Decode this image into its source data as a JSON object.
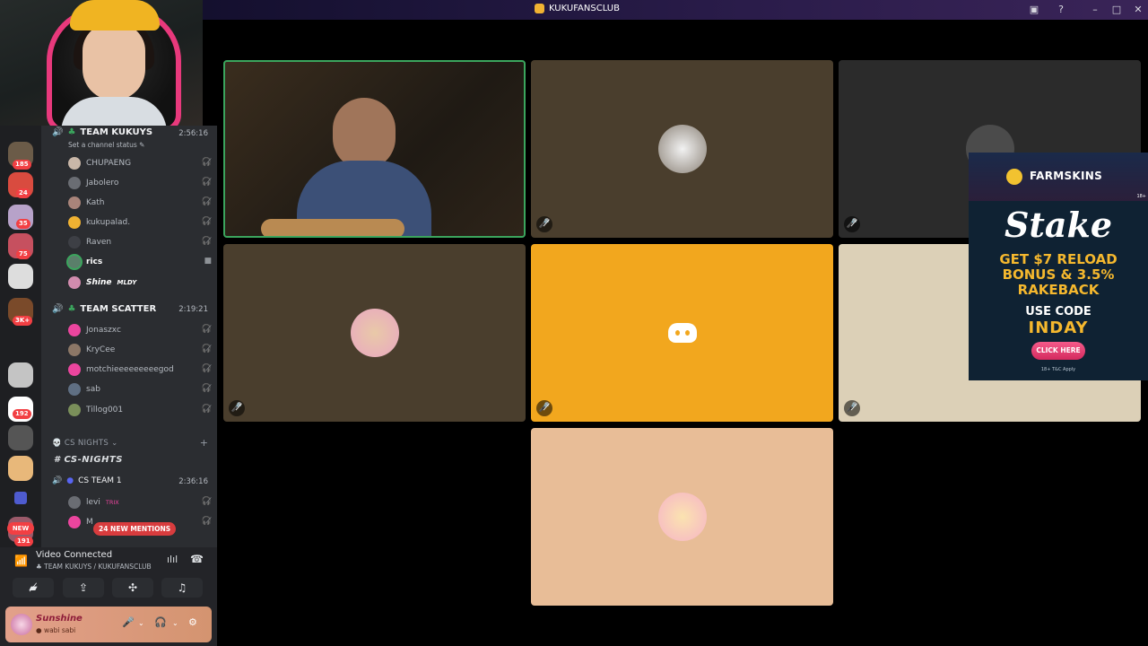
{
  "window": {
    "title": "KUKUFANSCLUB"
  },
  "voice_groups": [
    {
      "name": "TEAM KUKUYS",
      "time": "2:56:16",
      "status_placeholder": "Set a channel status",
      "members": [
        {
          "name": "CHUPAENG",
          "color": "#c9b7a8"
        },
        {
          "name": "Jabolero",
          "color": "#6a6d73"
        },
        {
          "name": "Kath",
          "color": "#a9847a"
        },
        {
          "name": "kukupalad.",
          "color": "#f0b232"
        },
        {
          "name": "Raven",
          "color": "#3d3f45"
        },
        {
          "name": "rics",
          "color": "#5a7f6a"
        },
        {
          "name": "Shine",
          "color": "#d28cae",
          "tag": "MLDY"
        }
      ]
    },
    {
      "name": "TEAM SCATTER",
      "time": "2:19:21",
      "members": [
        {
          "name": "Jonaszxc",
          "color": "#eb459e"
        },
        {
          "name": "KryCee",
          "color": "#8c7766"
        },
        {
          "name": "motchieeeeeeeeegod",
          "color": "#eb459e"
        },
        {
          "name": "sab",
          "color": "#5f6f83"
        },
        {
          "name": "Tillog001",
          "color": "#7a8f5a"
        }
      ]
    }
  ],
  "category": {
    "name": "CS NIGHTS",
    "text_channel": "CS-NIGHTS"
  },
  "cs_team": {
    "name": "CS TEAM 1",
    "time": "2:36:16",
    "members": [
      {
        "name": "levi",
        "color": "#6a6d73",
        "tag": "TRIX"
      },
      {
        "name": "M",
        "color": "#eb459e"
      }
    ]
  },
  "mentions_label": "24 NEW MENTIONS",
  "new_label": "NEW",
  "server_badges": [
    "185",
    "24",
    "35",
    "75",
    "3K+",
    "192",
    "191"
  ],
  "voice_panel": {
    "status": "Video Connected",
    "location": "TEAM KUKUYS / KUKUFANSCLUB"
  },
  "user": {
    "name": "Sunshine",
    "status": "wabi sabi"
  },
  "video_tiles": [
    {
      "kind": "video",
      "bg": "#2d2418",
      "speaking": true
    },
    {
      "kind": "avatar",
      "bg": "#4a3e2d",
      "avatar": "#d9d5cf"
    },
    {
      "kind": "avatar",
      "bg": "#2b2b2b",
      "avatar": "#4b4b4b"
    },
    {
      "kind": "avatar",
      "bg": "#4a3e2d",
      "avatar": "#e9a7c1"
    },
    {
      "kind": "discord",
      "bg": "#f2a71e"
    },
    {
      "kind": "avatar",
      "bg": "#dcd0b7",
      "avatar": "#cbb894"
    },
    {
      "kind": "avatar",
      "bg": "#e8bd97",
      "avatar": "#f6b4c7"
    }
  ],
  "ad": {
    "brand1": "FARMSKINS",
    "brand2": "Stake",
    "line1": "GET $7 RELOAD",
    "line2": "BONUS & 3.5%",
    "line3": "RAKEBACK",
    "code_label": "USE CODE",
    "code": "INDAY",
    "cta": "CLICK HERE",
    "fine_print": "18+  T&C Apply",
    "age": "18+"
  },
  "colors": {
    "speaking": "#3ba55d",
    "discord_blurple": "#5865f2",
    "mention_red": "#d83c3e"
  }
}
